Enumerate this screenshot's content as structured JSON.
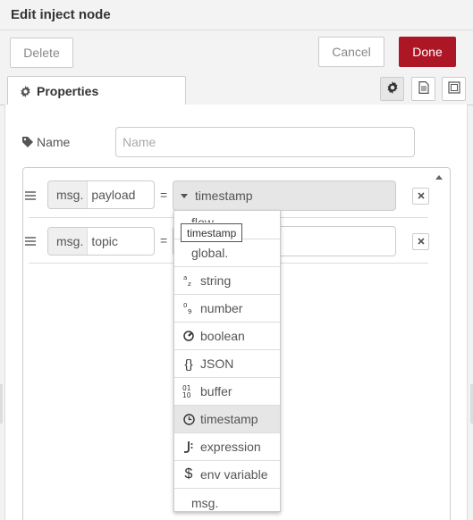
{
  "dialog": {
    "title": "Edit inject node",
    "delete_label": "Delete",
    "cancel_label": "Cancel",
    "done_label": "Done"
  },
  "tabs": {
    "properties_label": "Properties"
  },
  "form": {
    "name_label": "Name",
    "name_placeholder": "Name"
  },
  "props": [
    {
      "prefix": "msg.",
      "field": "payload",
      "eq": "=",
      "value_type": "timestamp"
    },
    {
      "prefix": "msg.",
      "field": "topic",
      "eq": "=",
      "value_type": ""
    }
  ],
  "dropdown": {
    "options": [
      {
        "label": "flow.",
        "icon": ""
      },
      {
        "label": "global.",
        "icon": ""
      },
      {
        "label": "string",
        "icon": "az-icon"
      },
      {
        "label": "number",
        "icon": "09-icon"
      },
      {
        "label": "boolean",
        "icon": "toggle-icon"
      },
      {
        "label": "JSON",
        "icon": "braces-icon"
      },
      {
        "label": "buffer",
        "icon": "binary-icon"
      },
      {
        "label": "timestamp",
        "icon": "clock-icon",
        "selected": true
      },
      {
        "label": "expression",
        "icon": "jsonata-icon"
      },
      {
        "label": "env variable",
        "icon": "dollar-icon"
      },
      {
        "label": "msg.",
        "icon": ""
      }
    ]
  },
  "tooltip": {
    "text": "timestamp"
  },
  "colors": {
    "accent": "#ad1625",
    "selected_bg": "#e6e6e6"
  }
}
